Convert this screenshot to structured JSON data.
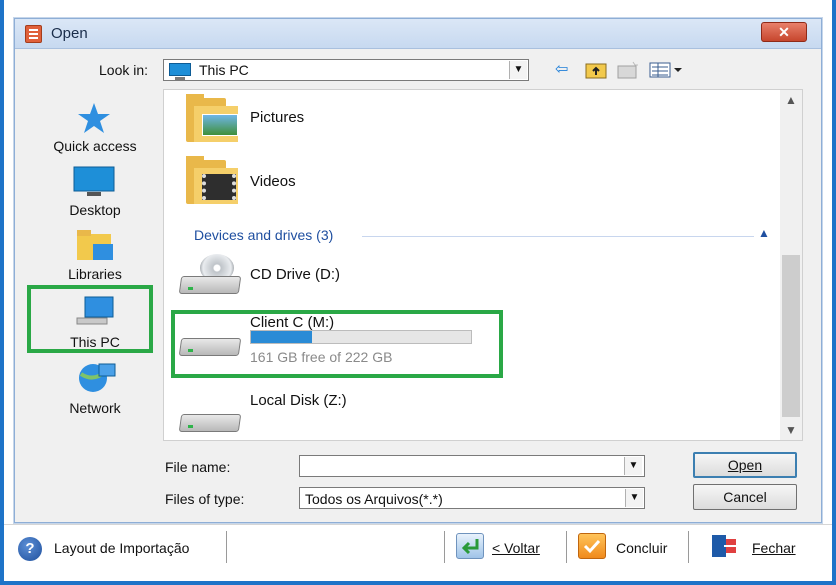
{
  "dialog": {
    "title": "Open",
    "close_glyph": "✕"
  },
  "toolbar": {
    "look_in_label": "Look in:",
    "look_in_value": "This PC",
    "icons": [
      "back-arrow-icon",
      "up-folder-icon",
      "new-folder-icon",
      "view-menu-icon"
    ]
  },
  "places": {
    "items": [
      {
        "label": "Quick access",
        "icon": "star-icon"
      },
      {
        "label": "Desktop",
        "icon": "desktop-icon"
      },
      {
        "label": "Libraries",
        "icon": "libraries-icon"
      },
      {
        "label": "This PC",
        "icon": "computer-icon",
        "selected": true
      },
      {
        "label": "Network",
        "icon": "network-icon"
      }
    ]
  },
  "files": {
    "folders": [
      {
        "name": "Pictures",
        "icon": "pictures-folder-icon"
      },
      {
        "name": "Videos",
        "icon": "videos-folder-icon"
      }
    ],
    "group_header": "Devices and drives (3)",
    "drives": [
      {
        "name": "CD Drive (D:)",
        "icon": "cd-drive-icon"
      },
      {
        "name": "Client C (M:)",
        "icon": "hard-drive-icon",
        "free_text": "161 GB free of 222 GB",
        "used_fraction": 0.275
      },
      {
        "name": "Local Disk (Z:)",
        "icon": "hard-drive-icon"
      }
    ]
  },
  "form": {
    "file_name_label": "File name:",
    "file_name_value": "",
    "files_of_type_label": "Files of type:",
    "files_of_type_value": "Todos os Arquivos(*.*)",
    "open_button": "Open",
    "cancel_button": "Cancel"
  },
  "bottom_bar": {
    "layout_label": "Layout de Importação",
    "back_button": "< Voltar",
    "finish_button": "Concluir",
    "close_button": "Fechar"
  },
  "colors": {
    "highlight_box": "#2aa846",
    "capacity_fill": "#2a8bd6",
    "group_header": "#1f4fa0"
  }
}
